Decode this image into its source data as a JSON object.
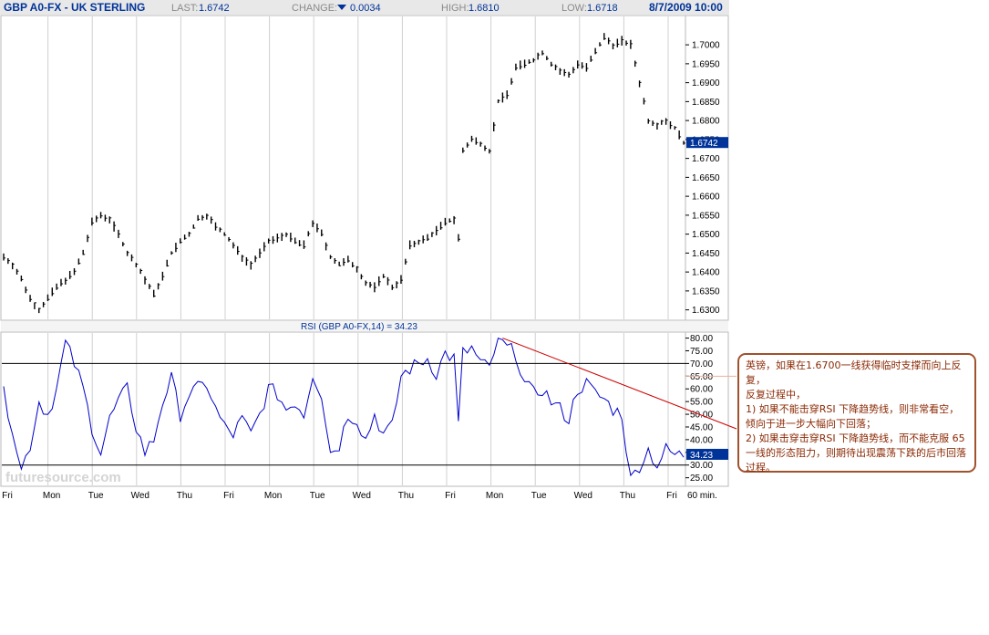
{
  "header": {
    "symbol": "GBP A0-FX - UK STERLING",
    "last_label": "LAST:",
    "last_value": "1.6742",
    "change_label": "CHANGE:",
    "change_value": "0.0034",
    "change_direction": "down",
    "high_label": "HIGH:",
    "high_value": "1.6810",
    "low_label": "LOW:",
    "low_value": "1.6718",
    "datetime": "8/7/2009 10:00"
  },
  "chart_data": [
    {
      "type": "bar",
      "name": "price",
      "ylim": [
        1.6275,
        1.7075
      ],
      "yticks": [
        "1.7000",
        "1.6950",
        "1.6900",
        "1.6850",
        "1.6800",
        "1.6750",
        "1.6700",
        "1.6650",
        "1.6600",
        "1.6550",
        "1.6500",
        "1.6450",
        "1.6400",
        "1.6350",
        "1.6300"
      ],
      "last_flag": "1.6742",
      "key_points": [
        [
          0,
          1.644
        ],
        [
          2,
          1.642
        ],
        [
          4,
          1.638
        ],
        [
          6,
          1.633
        ],
        [
          8,
          1.63
        ],
        [
          10,
          1.633
        ],
        [
          12,
          1.636
        ],
        [
          14,
          1.638
        ],
        [
          16,
          1.64
        ],
        [
          18,
          1.645
        ],
        [
          20,
          1.653
        ],
        [
          22,
          1.655
        ],
        [
          24,
          1.654
        ],
        [
          26,
          1.65
        ],
        [
          28,
          1.645
        ],
        [
          30,
          1.642
        ],
        [
          32,
          1.638
        ],
        [
          34,
          1.634
        ],
        [
          36,
          1.639
        ],
        [
          38,
          1.645
        ],
        [
          40,
          1.648
        ],
        [
          42,
          1.65
        ],
        [
          44,
          1.654
        ],
        [
          46,
          1.655
        ],
        [
          48,
          1.652
        ],
        [
          50,
          1.65
        ],
        [
          52,
          1.647
        ],
        [
          54,
          1.644
        ],
        [
          56,
          1.642
        ],
        [
          58,
          1.645
        ],
        [
          60,
          1.648
        ],
        [
          62,
          1.649
        ],
        [
          64,
          1.65
        ],
        [
          66,
          1.648
        ],
        [
          68,
          1.647
        ],
        [
          70,
          1.653
        ],
        [
          72,
          1.65
        ],
        [
          74,
          1.644
        ],
        [
          76,
          1.642
        ],
        [
          78,
          1.643
        ],
        [
          80,
          1.641
        ],
        [
          82,
          1.637
        ],
        [
          84,
          1.636
        ],
        [
          86,
          1.639
        ],
        [
          88,
          1.636
        ],
        [
          90,
          1.638
        ],
        [
          92,
          1.647
        ],
        [
          94,
          1.648
        ],
        [
          96,
          1.649
        ],
        [
          98,
          1.651
        ],
        [
          100,
          1.653
        ],
        [
          102,
          1.654
        ],
        [
          103,
          1.649
        ],
        [
          104,
          1.672
        ],
        [
          106,
          1.675
        ],
        [
          108,
          1.674
        ],
        [
          110,
          1.672
        ],
        [
          112,
          1.685
        ],
        [
          114,
          1.687
        ],
        [
          116,
          1.694
        ],
        [
          118,
          1.695
        ],
        [
          120,
          1.696
        ],
        [
          122,
          1.698
        ],
        [
          124,
          1.695
        ],
        [
          126,
          1.693
        ],
        [
          128,
          1.692
        ],
        [
          130,
          1.695
        ],
        [
          132,
          1.694
        ],
        [
          134,
          1.698
        ],
        [
          136,
          1.702
        ],
        [
          138,
          1.7
        ],
        [
          140,
          1.701
        ],
        [
          142,
          1.7
        ],
        [
          144,
          1.69
        ],
        [
          146,
          1.68
        ],
        [
          148,
          1.679
        ],
        [
          150,
          1.68
        ],
        [
          152,
          1.678
        ],
        [
          154,
          1.6742
        ]
      ],
      "x_count": 155
    },
    {
      "type": "line",
      "name": "rsi",
      "title": "RSI (GBP A0-FX,14) = 34.23",
      "ylim": [
        22,
        82
      ],
      "yticks": [
        "80.00",
        "75.00",
        "70.00",
        "65.00",
        "60.00",
        "55.00",
        "50.00",
        "45.00",
        "40.00",
        "35.00",
        "30.00",
        "25.00"
      ],
      "last_flag": "34.23",
      "hlines": [
        70,
        30
      ],
      "trendline": {
        "from": [
          113,
          80
        ],
        "to": [
          159,
          49
        ]
      },
      "key_points": [
        [
          0,
          58
        ],
        [
          2,
          45
        ],
        [
          4,
          28
        ],
        [
          6,
          38
        ],
        [
          8,
          55
        ],
        [
          10,
          50
        ],
        [
          12,
          60
        ],
        [
          14,
          78
        ],
        [
          16,
          70
        ],
        [
          18,
          60
        ],
        [
          20,
          45
        ],
        [
          22,
          35
        ],
        [
          24,
          48
        ],
        [
          26,
          55
        ],
        [
          28,
          60
        ],
        [
          30,
          45
        ],
        [
          32,
          35
        ],
        [
          34,
          40
        ],
        [
          36,
          55
        ],
        [
          38,
          64
        ],
        [
          40,
          50
        ],
        [
          42,
          58
        ],
        [
          44,
          60
        ],
        [
          46,
          62
        ],
        [
          48,
          52
        ],
        [
          50,
          45
        ],
        [
          52,
          42
        ],
        [
          54,
          48
        ],
        [
          56,
          42
        ],
        [
          58,
          50
        ],
        [
          60,
          60
        ],
        [
          62,
          58
        ],
        [
          64,
          52
        ],
        [
          66,
          55
        ],
        [
          68,
          50
        ],
        [
          70,
          66
        ],
        [
          72,
          58
        ],
        [
          74,
          35
        ],
        [
          76,
          38
        ],
        [
          78,
          50
        ],
        [
          80,
          48
        ],
        [
          82,
          40
        ],
        [
          84,
          50
        ],
        [
          86,
          42
        ],
        [
          88,
          45
        ],
        [
          90,
          65
        ],
        [
          92,
          68
        ],
        [
          94,
          70
        ],
        [
          96,
          72
        ],
        [
          98,
          66
        ],
        [
          100,
          74
        ],
        [
          102,
          72
        ],
        [
          103,
          46
        ],
        [
          104,
          74
        ],
        [
          106,
          76
        ],
        [
          108,
          70
        ],
        [
          110,
          68
        ],
        [
          112,
          80
        ],
        [
          114,
          76
        ],
        [
          116,
          74
        ],
        [
          118,
          62
        ],
        [
          120,
          58
        ],
        [
          122,
          60
        ],
        [
          124,
          55
        ],
        [
          126,
          52
        ],
        [
          128,
          48
        ],
        [
          130,
          60
        ],
        [
          132,
          62
        ],
        [
          134,
          58
        ],
        [
          136,
          56
        ],
        [
          138,
          52
        ],
        [
          140,
          50
        ],
        [
          142,
          24
        ],
        [
          144,
          30
        ],
        [
          146,
          36
        ],
        [
          148,
          30
        ],
        [
          150,
          36
        ],
        [
          152,
          34
        ]
      ],
      "x_count": 155
    }
  ],
  "x_axis": {
    "labels": [
      "Fri",
      "Mon",
      "Tue",
      "Wed",
      "Thu",
      "Fri",
      "Mon",
      "Tue",
      "Wed",
      "Thu",
      "Fri",
      "Mon",
      "Tue",
      "Wed",
      "Thu",
      "Fri"
    ],
    "interval": "60 min."
  },
  "watermark": "futuresource.com",
  "annotation": {
    "line1": "英镑，如果在1.6700一线获得临时支撑而向上反复，",
    "line2": "反复过程中，",
    "line3": "1) 如果不能击穿RSI 下降趋势线，则非常看空，倾向于进一步大幅向下回落；",
    "line4": "2) 如果击穿击穿RSI 下降趋势线，而不能克服 65 一线的形态阻力，则期待出现震荡下跌的后市回落过程。"
  },
  "colors": {
    "price": "#000000",
    "rsi": "#0000cc",
    "trendline": "#cc0000",
    "flag": "#003399",
    "annotation_border": "#a0522d",
    "annotation_text": "#8b2a05",
    "grid": "#d0d0d0"
  }
}
